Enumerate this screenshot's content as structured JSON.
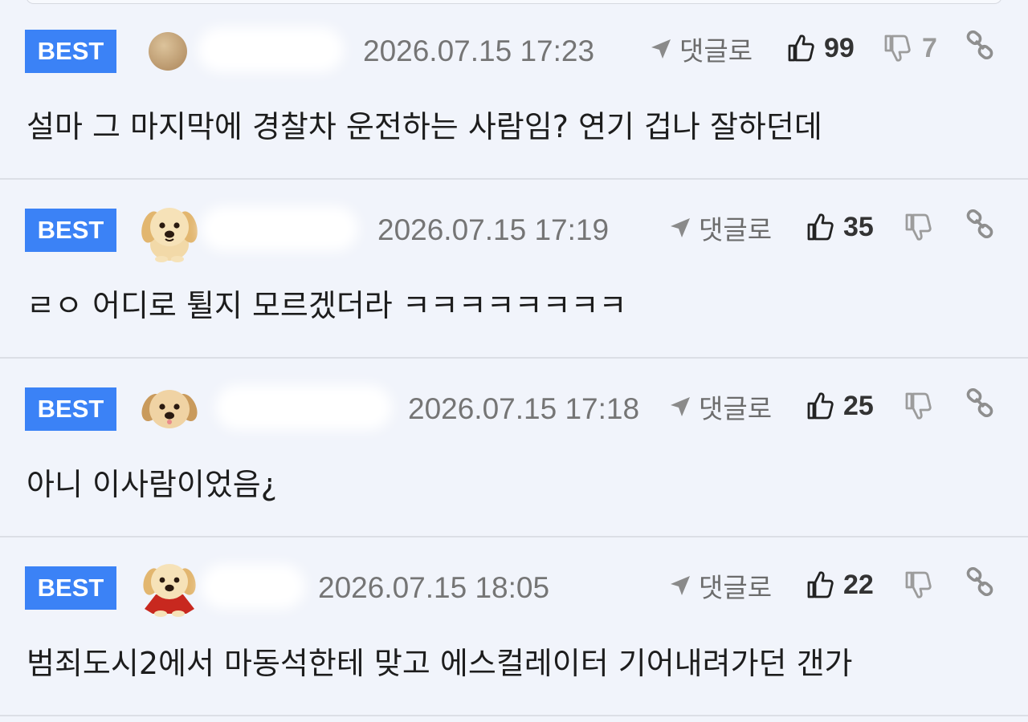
{
  "comments": [
    {
      "badge": "BEST",
      "avatar_icon": "round-beige-avatar-icon",
      "date": "2026.07.15 17:23",
      "reply_label": "댓글로",
      "likes": "99",
      "dislikes": "7",
      "text": "설마 그 마지막에 경찰차 운전하는 사람임? 연기 겁나 잘하던데"
    },
    {
      "badge": "BEST",
      "avatar_icon": "puppy-avatar-icon",
      "date": "2026.07.15 17:19",
      "reply_label": "댓글로",
      "likes": "35",
      "dislikes": "",
      "text": "ㄹㅇ 어디로 튈지 모르겠더라 ㅋㅋㅋㅋㅋㅋㅋㅋ"
    },
    {
      "badge": "BEST",
      "avatar_icon": "puppy-avatar-icon",
      "date": "2026.07.15 17:18",
      "reply_label": "댓글로",
      "likes": "25",
      "dislikes": "",
      "text": "아니 이사람이었음¿"
    },
    {
      "badge": "BEST",
      "avatar_icon": "puppy-with-red-cape-avatar-icon",
      "date": "2026.07.15 18:05",
      "reply_label": "댓글로",
      "likes": "22",
      "dislikes": "",
      "text": "범죄도시2에서 마동석한테 맞고 에스컬레이터 기어내려가던 갠가"
    }
  ],
  "colors": {
    "best_badge": "#3b82f6",
    "background": "#f1f4fb",
    "divider": "#dcdfe6"
  }
}
